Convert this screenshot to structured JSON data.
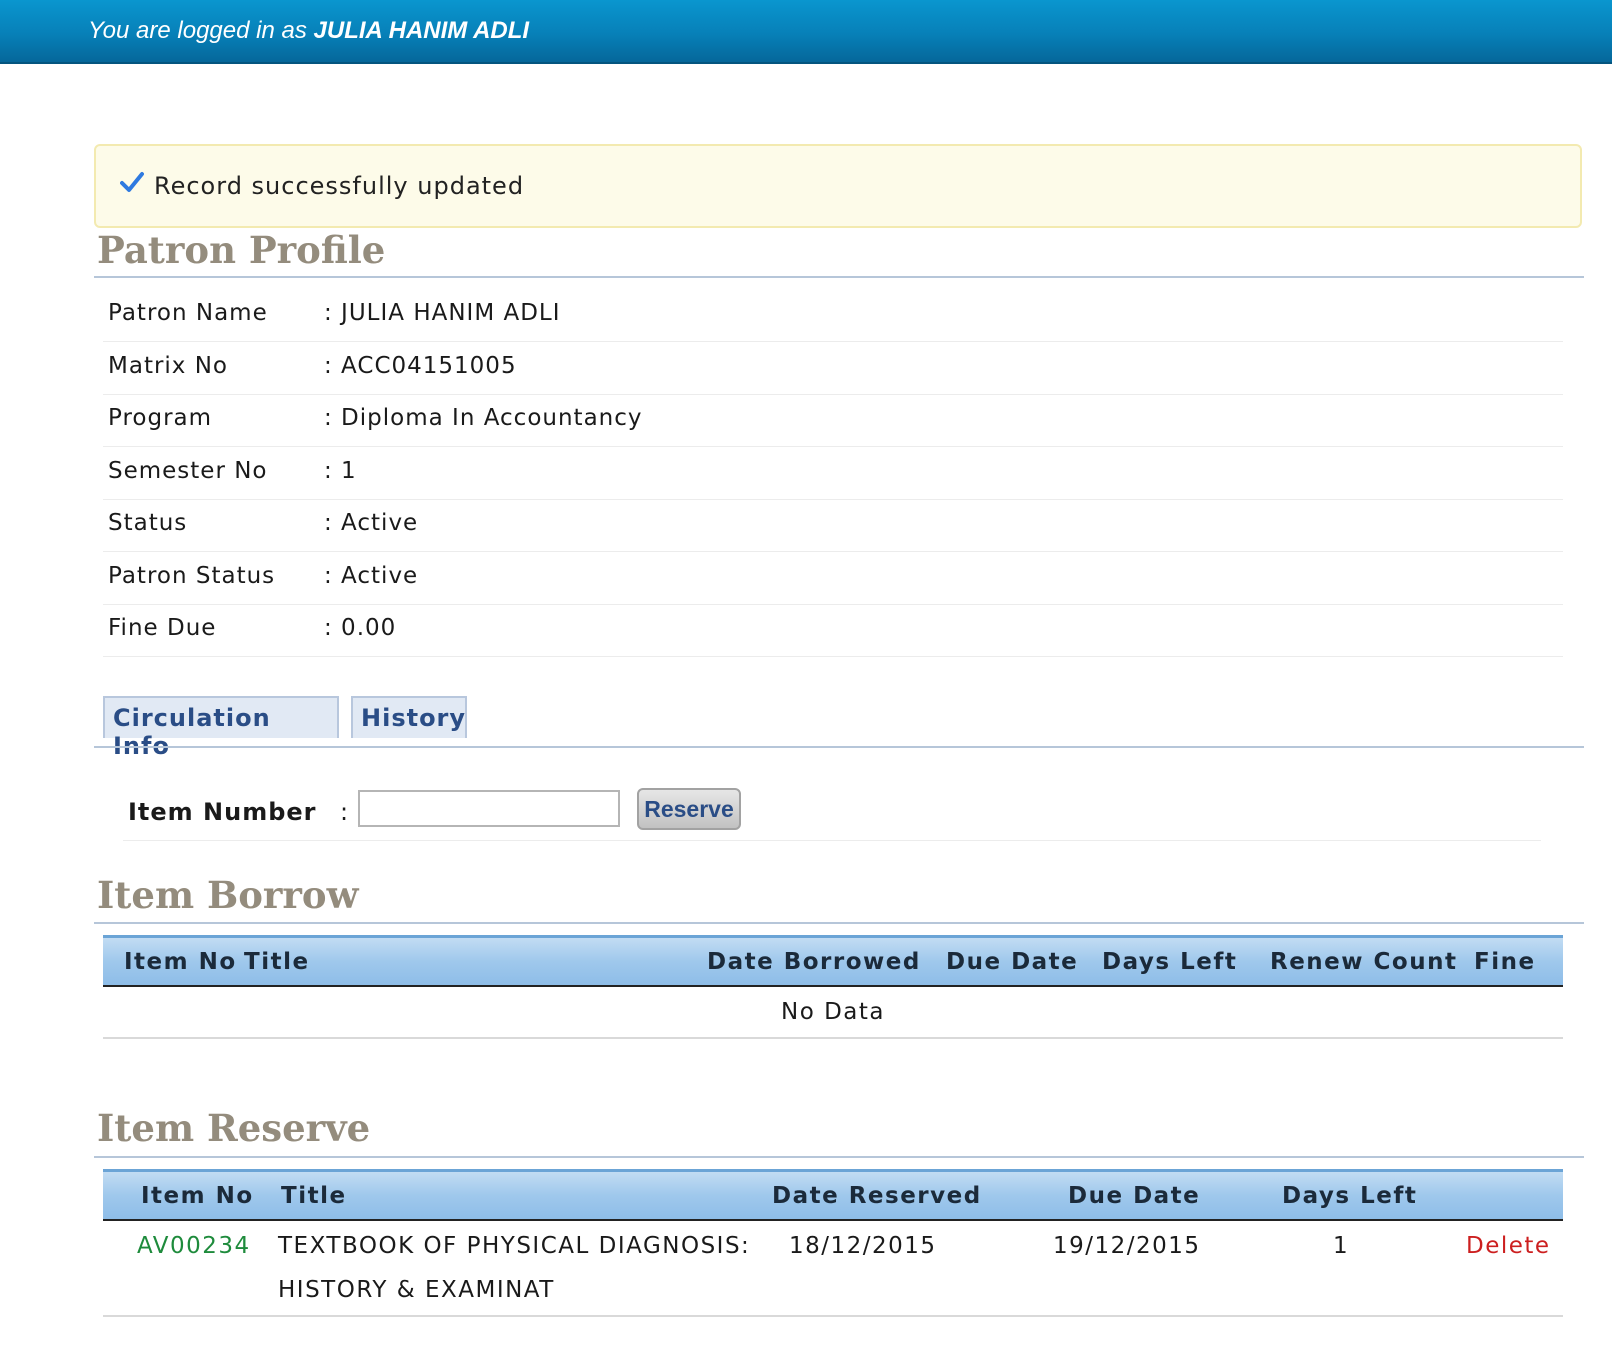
{
  "header": {
    "login_prefix": "You are logged in as",
    "user_name": "JULIA HANIM ADLI"
  },
  "alert": {
    "icon": "check-icon",
    "message": "Record successfully updated",
    "color": "#fdfbe9"
  },
  "profile": {
    "title": "Patron Profile",
    "rows": [
      {
        "label": "Patron Name",
        "value": ": JULIA HANIM ADLI"
      },
      {
        "label": "Matrix No",
        "value": ": ACC04151005"
      },
      {
        "label": "Program",
        "value": ": Diploma In Accountancy"
      },
      {
        "label": "Semester No",
        "value": ": 1"
      },
      {
        "label": "Status",
        "value": ": Active"
      },
      {
        "label": "Patron Status",
        "value": ": Active"
      },
      {
        "label": "Fine Due",
        "value": ": 0.00"
      }
    ]
  },
  "tabs": [
    {
      "label": "Circulation Info"
    },
    {
      "label": "History"
    }
  ],
  "reserve_form": {
    "label": "Item Number",
    "colon": ":",
    "value": "",
    "placeholder": "",
    "button_label": "Reserve"
  },
  "borrow": {
    "title": "Item Borrow",
    "columns": [
      "Item No",
      "Title",
      "Date Borrowed",
      "Due Date",
      "Days Left",
      "Renew Count",
      "Fine"
    ],
    "empty_text": "No Data"
  },
  "reserve": {
    "title": "Item Reserve",
    "columns": [
      "Item No",
      "Title",
      "Date Reserved",
      "Due Date",
      "Days Left"
    ],
    "rows": [
      {
        "item_no": "AV00234",
        "title_line1": "TEXTBOOK OF PHYSICAL DIAGNOSIS:",
        "title_line2": "HISTORY & EXAMINAT",
        "date_reserved": "18/12/2015",
        "due_date": "19/12/2015",
        "days_left": "1",
        "action": "Delete"
      }
    ]
  },
  "colors": {
    "header_blue": "#0780b8",
    "link_green": "#1e8b3c",
    "delete_red": "#cc1f1f",
    "heading_taupe": "#948c7d"
  }
}
